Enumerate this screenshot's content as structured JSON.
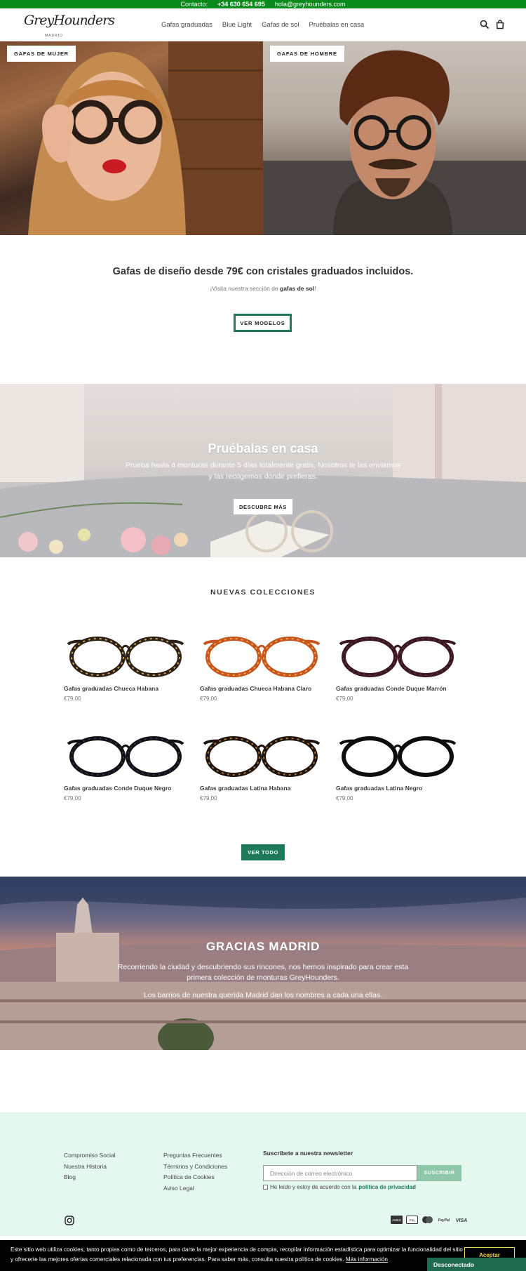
{
  "topbar": {
    "contact_label": "Contacto:",
    "phone": "+34 630 654 695",
    "email": "hola@greyhounders.com"
  },
  "header": {
    "logo_text": "GreyHounders",
    "logo_sub": "MADRID",
    "nav": [
      "Gafas graduadas",
      "Blue Light",
      "Gafas de sol",
      "Pruébalas en casa"
    ]
  },
  "hero": {
    "women_label": "GAFAS DE MUJER",
    "men_label": "GAFAS DE HOMBRE"
  },
  "intro": {
    "title": "Gafas de diseño desde 79€ con cristales graduados incluidos.",
    "sub_prefix": "¡Visita nuestra sección de ",
    "sub_link": "gafas de sol",
    "sub_suffix": "!",
    "button": "VER MODELOS"
  },
  "try_home": {
    "title": "Pruébalas en casa",
    "text": "Prueba hasta 4 monturas durante 5 días totalmente gratis. Nosotros te las enviamos y las recogemos donde prefieras.",
    "button": "DESCUBRE MÁS"
  },
  "collections": {
    "title": "NUEVAS COLECCIONES",
    "products": [
      {
        "name": "Gafas graduadas Chueca Habana",
        "price": "€79,00",
        "frame_color": "#2b2118",
        "accent": "#c9a24a"
      },
      {
        "name": "Gafas graduadas Chueca Habana Claro",
        "price": "€79,00",
        "frame_color": "#c6561c",
        "accent": "#e8a050"
      },
      {
        "name": "Gafas graduadas Conde Duque Marrón",
        "price": "€79,00",
        "frame_color": "#3a1820",
        "accent": "#5a2a34"
      },
      {
        "name": "Gafas graduadas Conde Duque Negro",
        "price": "€79,00",
        "frame_color": "#111111",
        "accent": "#2a2f55"
      },
      {
        "name": "Gafas graduadas Latina Habana",
        "price": "€79,00",
        "frame_color": "#1e1410",
        "accent": "#a8742e"
      },
      {
        "name": "Gafas graduadas Latina Negro",
        "price": "€79,00",
        "frame_color": "#0d0d0d",
        "accent": "#0d0d0d"
      }
    ],
    "button": "VER TODO"
  },
  "madrid": {
    "title": "GRACIAS MADRID",
    "text": "Recorriendo la ciudad y descubriendo sus rincones, nos hemos inspirado para crear esta primera colección de monturas GreyHounders.",
    "text2": "Los barrios de nuestra querida Madrid dan los nombres a cada una ellas."
  },
  "footer": {
    "col1": [
      "Compromiso Social",
      "Nuestra Historia",
      "Blog"
    ],
    "col2": [
      "Preguntas Frecuentes",
      "Términos y Condiciones",
      "Política de Cookies",
      "Aviso Legal"
    ],
    "newsletter_title": "Suscríbete a nuestra newsletter",
    "email_placeholder": "Dirección de correo electrónico",
    "subscribe": "SUSCRIBIR",
    "consent_prefix": "He leído y estoy de acuerdo con la ",
    "consent_link": "política de privacidad",
    "payments": [
      "AMEX",
      "Pay",
      "mc",
      "PayPal",
      "VISA"
    ]
  },
  "cookie": {
    "text": "Este sitio web utiliza cookies, tanto propias como de terceros, para darte la mejor experiencia de compra, recopilar información estadística para optimizar la funcionalidad del sitio y ofrecerte las mejores ofertas comerciales relacionada con tus preferencias. Para saber más, consulta nuestra política de cookies.",
    "link": "Más información",
    "accept": "Aceptar",
    "status": "Desconectado"
  },
  "colors": {
    "topbar": "#0a8a1b",
    "brand_green": "#1f7a5a",
    "footer_bg": "#e4f8ef"
  }
}
